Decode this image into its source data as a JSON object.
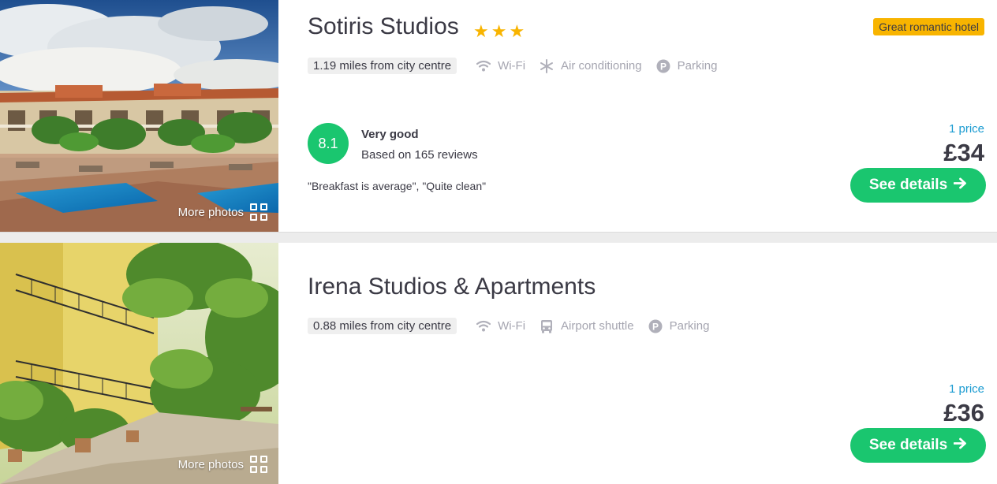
{
  "listings": [
    {
      "title": "Sotiris Studios",
      "stars": "★★★",
      "badge": "Great romantic hotel",
      "distance": "1.19 miles from city centre",
      "amenities": [
        {
          "icon": "wifi-icon",
          "label": "Wi-Fi"
        },
        {
          "icon": "snowflake-icon",
          "label": "Air conditioning"
        },
        {
          "icon": "parking-icon",
          "label": "Parking"
        }
      ],
      "rating": {
        "score": "8.1",
        "word": "Very good",
        "reviews": "Based on 165 reviews"
      },
      "quote": "\"Breakfast is average\", \"Quite clean\"",
      "price_count": "1 price",
      "price": "£34",
      "button_label": "See details",
      "more_photos": "More photos"
    },
    {
      "title": "Irena Studios & Apartments",
      "distance": "0.88 miles from city centre",
      "amenities": [
        {
          "icon": "wifi-icon",
          "label": "Wi-Fi"
        },
        {
          "icon": "bus-icon",
          "label": "Airport shuttle"
        },
        {
          "icon": "parking-icon",
          "label": "Parking"
        }
      ],
      "price_count": "1 price",
      "price": "£36",
      "button_label": "See details",
      "more_photos": "More photos"
    }
  ],
  "colors": {
    "accent_green": "#1ac66f",
    "badge_yellow": "#f8b400",
    "price_blue": "#1a9bd1",
    "text_dark": "#3b3a45",
    "text_muted": "#a5a5b0"
  }
}
